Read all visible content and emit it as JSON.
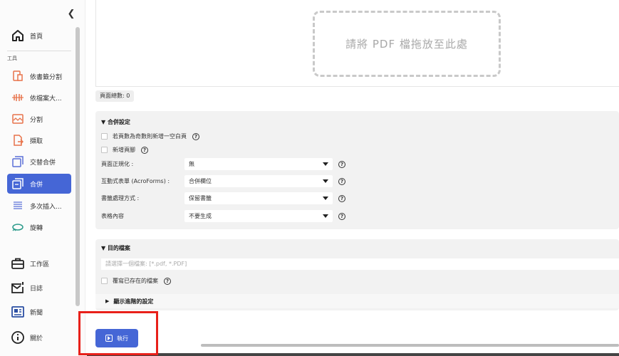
{
  "sidebar": {
    "collapse_icon": "chevron-left-icon",
    "home": {
      "label": "首頁",
      "icon": "home-icon"
    },
    "section_label": "工具",
    "tools": [
      {
        "label": "依書籤分割",
        "icon": "bookmark-split-icon"
      },
      {
        "label": "依檔案大...",
        "icon": "size-split-icon"
      },
      {
        "label": "分割",
        "icon": "split-icon"
      },
      {
        "label": "擷取",
        "icon": "extract-icon"
      },
      {
        "label": "交替合併",
        "icon": "alternate-merge-icon"
      },
      {
        "label": "合併",
        "icon": "merge-icon",
        "active": true
      },
      {
        "label": "多次插入...",
        "icon": "multi-insert-icon"
      },
      {
        "label": "旋轉",
        "icon": "rotate-icon"
      }
    ],
    "bottom": [
      {
        "label": "工作區",
        "icon": "briefcase-icon"
      },
      {
        "label": "日誌",
        "icon": "log-icon"
      },
      {
        "label": "新聞",
        "icon": "news-icon"
      },
      {
        "label": "關於",
        "icon": "info-icon"
      }
    ]
  },
  "main": {
    "drop_text": "請將 PDF 檔拖放至此處",
    "page_count": "頁面總數: 0",
    "merge_settings": {
      "title": "合併設定",
      "checkboxes": [
        {
          "label": "若頁數為奇數則新增一空白頁",
          "checked": false
        },
        {
          "label": "新增頁腳",
          "checked": false
        }
      ],
      "fields": [
        {
          "label": "頁面正規化 :",
          "value": "無"
        },
        {
          "label": "互動式表單 (AcroForms) :",
          "value": "合併欄位"
        },
        {
          "label": "書籤處理方式 :",
          "value": "保留書籤"
        },
        {
          "label": "表格內容",
          "value": "不要生成"
        }
      ]
    },
    "destination": {
      "title": "目的檔案",
      "placeholder": "請選擇一個檔案: [*.pdf, *.PDF]",
      "overwrite_label": "覆寫已存在的檔案",
      "advanced_label": "顯示進階的設定"
    },
    "run_label": "執行"
  },
  "colors": {
    "accent": "#4566d6",
    "highlight": "#e8201a"
  }
}
